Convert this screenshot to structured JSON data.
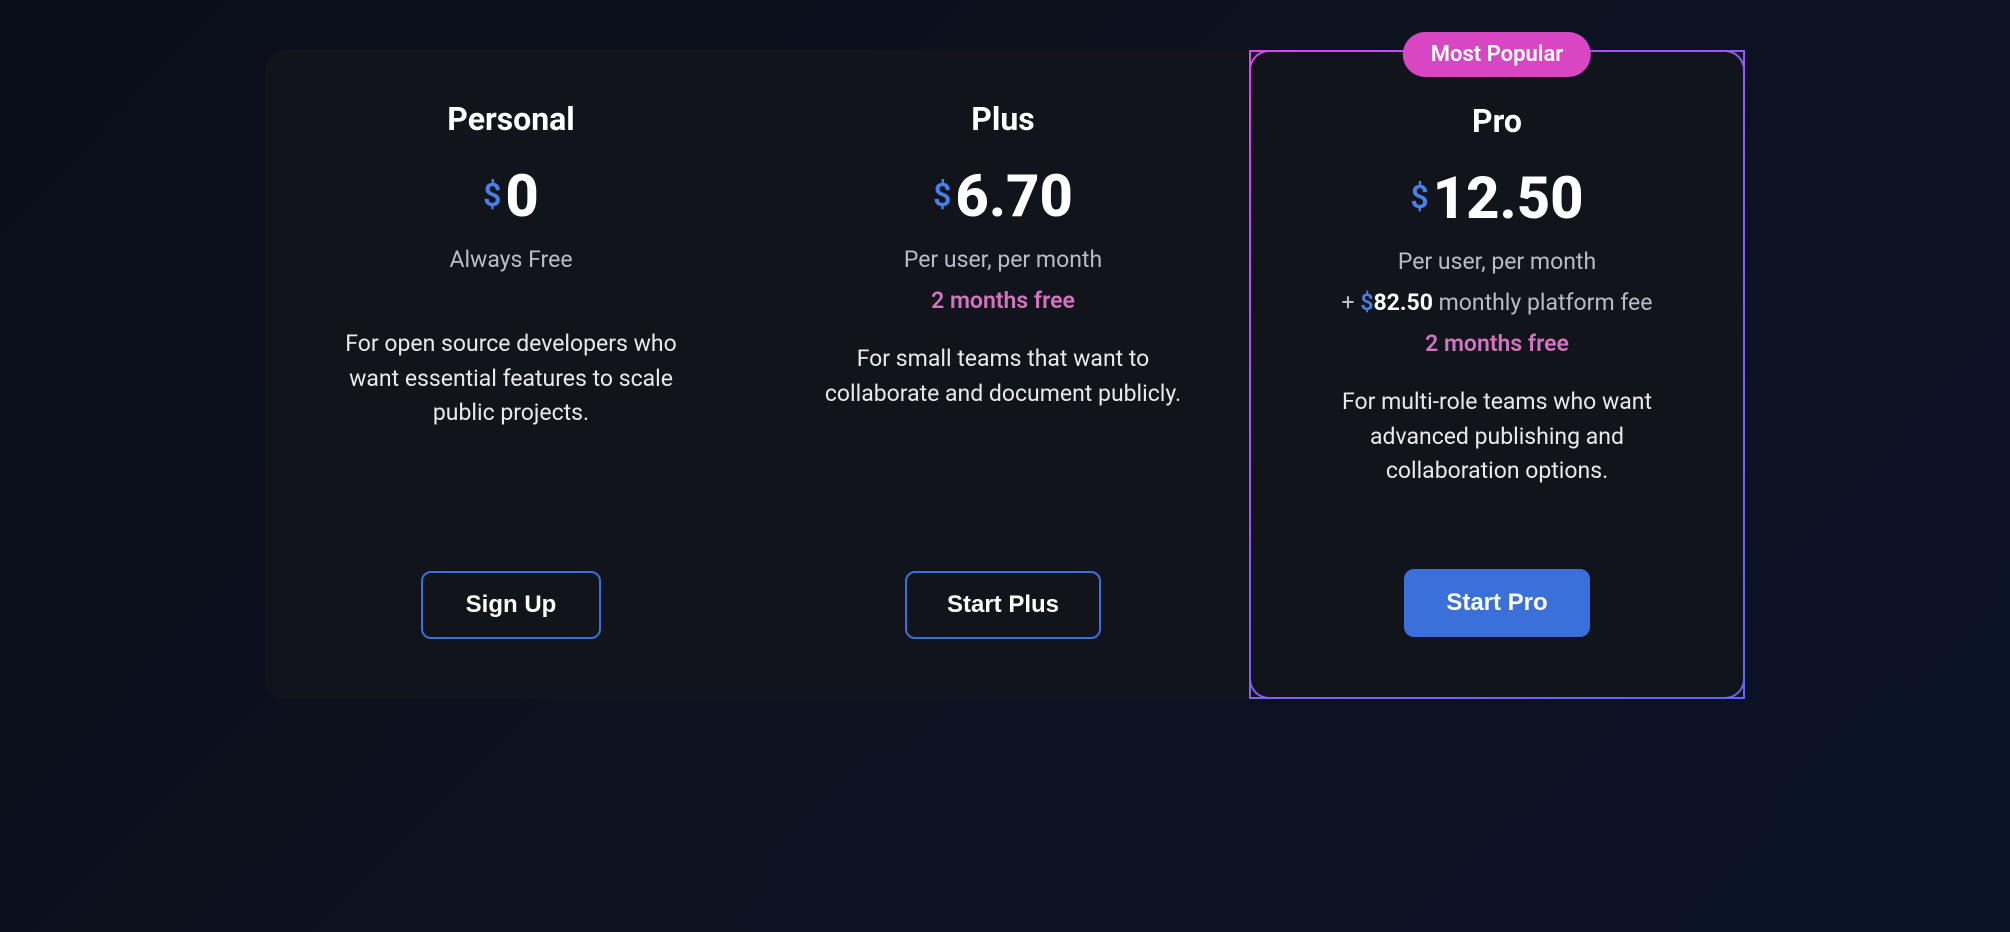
{
  "plans": [
    {
      "name": "Personal",
      "currency": "$",
      "price": "0",
      "subtitle": "Always Free",
      "platform_fee": null,
      "promo": null,
      "description": "For open source developers who want essential features to scale public projects.",
      "cta_label": "Sign Up",
      "cta_primary": false,
      "badge": null
    },
    {
      "name": "Plus",
      "currency": "$",
      "price": "6.70",
      "subtitle": "Per user, per month",
      "platform_fee": null,
      "promo": "2 months free",
      "description": "For small teams that want to collaborate and document publicly.",
      "cta_label": "Start Plus",
      "cta_primary": false,
      "badge": null
    },
    {
      "name": "Pro",
      "currency": "$",
      "price": "12.50",
      "subtitle": "Per user, per month",
      "platform_fee": {
        "prefix": "+ ",
        "currency": "$",
        "amount": "82.50",
        "suffix": " monthly platform fee"
      },
      "promo": "2 months free",
      "description": "For multi-role teams who want advanced publishing and collaboration options.",
      "cta_label": "Start Pro",
      "cta_primary": true,
      "badge": "Most Popular"
    }
  ]
}
